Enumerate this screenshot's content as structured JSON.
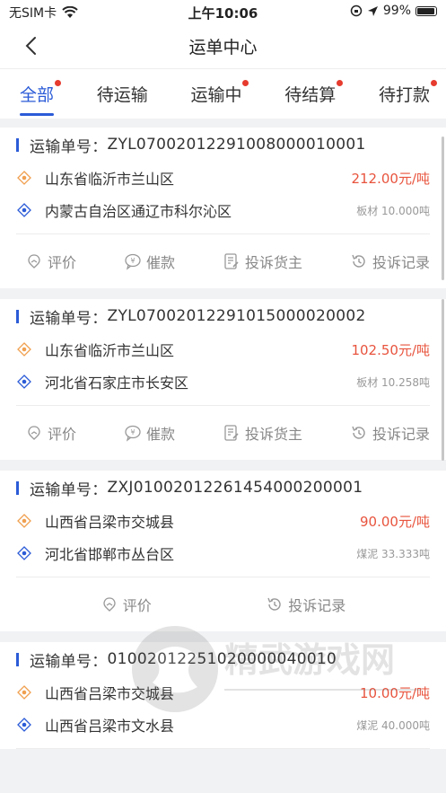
{
  "status": {
    "carrier": "无SIM卡",
    "time": "上午10:06",
    "battery": "99%"
  },
  "nav": {
    "title": "运单中心"
  },
  "tabs": [
    {
      "label": "全部",
      "active": true,
      "dot": true
    },
    {
      "label": "待运输",
      "active": false,
      "dot": false
    },
    {
      "label": "运输中",
      "active": false,
      "dot": true
    },
    {
      "label": "待结算",
      "active": false,
      "dot": true
    },
    {
      "label": "待打款",
      "active": false,
      "dot": true
    }
  ],
  "orders": [
    {
      "prefix": "运输单号：",
      "number": "ZYL07002012291008000010001",
      "origin": "山东省临沂市兰山区",
      "price": "212.00元/吨",
      "dest": "内蒙古自治区通辽市科尔沁区",
      "cargo": "板材 10.000吨",
      "actions": [
        "评价",
        "催款",
        "投诉货主",
        "投诉记录"
      ]
    },
    {
      "prefix": "运输单号：",
      "number": "ZYL07002012291015000020002",
      "origin": "山东省临沂市兰山区",
      "price": "102.50元/吨",
      "dest": "河北省石家庄市长安区",
      "cargo": "板材 10.258吨",
      "actions": [
        "评价",
        "催款",
        "投诉货主",
        "投诉记录"
      ]
    },
    {
      "prefix": "运输单号：",
      "number": "ZXJ01002012261454000200001",
      "origin": "山西省吕梁市交城县",
      "price": "90.00元/吨",
      "dest": "河北省邯郸市丛台区",
      "cargo": "煤泥 33.333吨",
      "actions": [
        "评价",
        "投诉记录"
      ]
    },
    {
      "prefix": "运输单号：",
      "number": "01002012251020000040010",
      "origin": "山西省吕梁市交城县",
      "price": "10.00元/吨",
      "dest": "山西省吕梁市文水县",
      "cargo": "煤泥 40.000吨"
    }
  ],
  "watermark": "精武游戏网",
  "colors": {
    "accent": "#2b5bd7",
    "price": "#e8543e",
    "origin_icon": "#f0a050",
    "dest_icon": "#2b5bd7"
  }
}
